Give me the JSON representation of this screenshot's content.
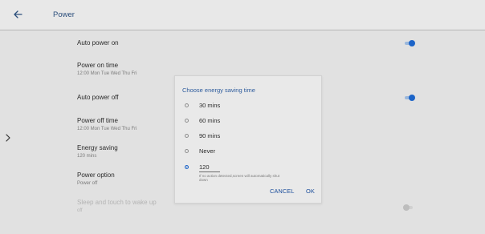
{
  "header": {
    "title": "Power"
  },
  "settings": {
    "auto_power_on": {
      "title": "Auto power on",
      "enabled": true
    },
    "power_on_time": {
      "title": "Power on time",
      "subtitle": "12:00 Mon Tue Wed Thu Fri"
    },
    "auto_power_off": {
      "title": "Auto power off",
      "enabled": true
    },
    "power_off_time": {
      "title": "Power off time",
      "subtitle": "12:00 Mon Tue Wed Thu Fri"
    },
    "energy_saving": {
      "title": "Energy saving",
      "subtitle": "120 mins"
    },
    "power_option": {
      "title": "Power option",
      "subtitle": "Power off"
    },
    "sleep_touch": {
      "title": "Sleep and touch to wake up",
      "subtitle": "off",
      "enabled": false
    }
  },
  "dialog": {
    "title": "Choose energy saving time",
    "options": [
      {
        "label": "30 mins",
        "selected": false
      },
      {
        "label": "60 mins",
        "selected": false
      },
      {
        "label": "90 mins",
        "selected": false
      },
      {
        "label": "Never",
        "selected": false
      }
    ],
    "custom": {
      "value": "120",
      "selected": true
    },
    "hint": "If no action detected,screen will automatically shut down",
    "cancel_label": "CANCEL",
    "ok_label": "OK"
  },
  "colors": {
    "accent": "#1c64c8",
    "title_blue": "#2c4f7c",
    "background": "#e1e1e1"
  },
  "icons": {
    "back": "arrow-left-icon",
    "side": "chevron-right-icon"
  }
}
